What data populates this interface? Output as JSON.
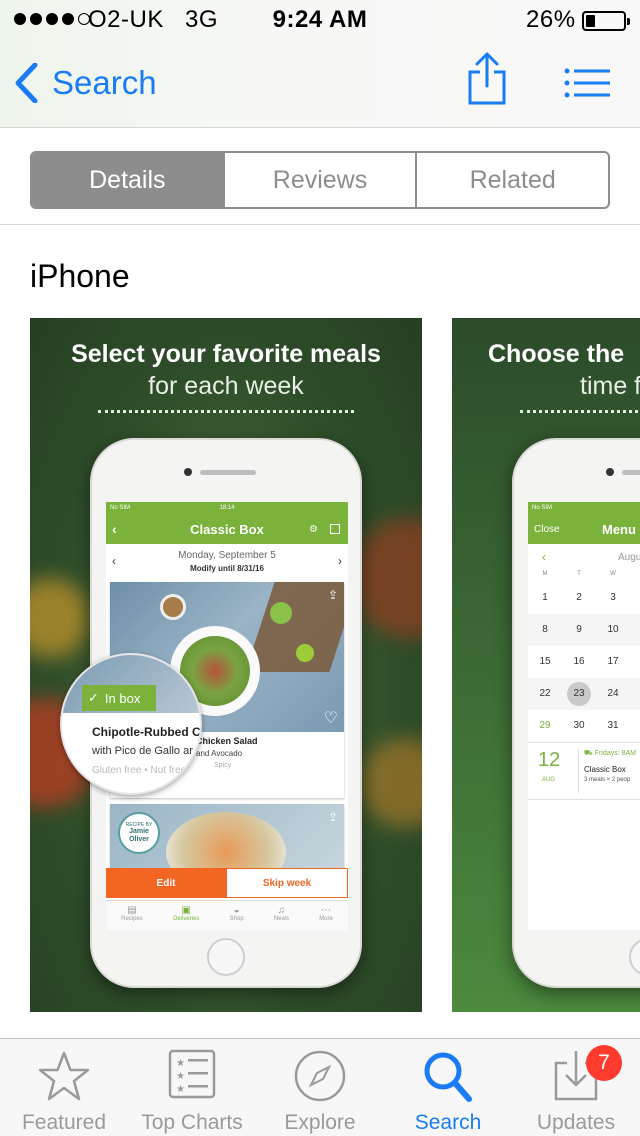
{
  "status_bar": {
    "carrier": "O2-UK",
    "network": "3G",
    "time": "9:24 AM",
    "battery": "26%",
    "battery_level": 0.26
  },
  "nav": {
    "back_label": "Search"
  },
  "segments": [
    {
      "label": "Details",
      "active": true
    },
    {
      "label": "Reviews",
      "active": false
    },
    {
      "label": "Related",
      "active": false
    }
  ],
  "section_title": "iPhone",
  "screenshot1": {
    "headline": "Select your favorite meals",
    "subline": "for each week",
    "app": {
      "status_left": "No SIM",
      "status_time": "18:14",
      "title": "Classic Box",
      "date": "Monday, September 5",
      "modify": "Modify until 8/31/16",
      "card_title": "Chicken Salad",
      "card_subtitle": "and Avocado",
      "card_tags": "Spicy",
      "badge": "In box",
      "zoom_title": "Chipotle-Rubbed C",
      "zoom_subtitle": "with Pico de Gallo ar",
      "zoom_tags": "Gluten free",
      "zoom_tags2": "Nut free",
      "chef_top": "RECIPE BY",
      "chef_name": "Jamie Oliver",
      "edit": "Edit",
      "skip": "Skip week",
      "tabs": [
        "Recipes",
        "Deliveries",
        "Shop",
        "News",
        "More"
      ]
    }
  },
  "screenshot2": {
    "headline": "Choose the",
    "subline": "time f",
    "app": {
      "status_left": "No SIM",
      "close": "Close",
      "title": "Menu C",
      "month": "Augu",
      "weekdays": [
        "M",
        "T",
        "W"
      ],
      "weeks": [
        [
          "1",
          "2",
          "3"
        ],
        [
          "8",
          "9",
          "10"
        ],
        [
          "15",
          "16",
          "17"
        ],
        [
          "22",
          "23",
          "24"
        ],
        [
          "29",
          "30",
          "31"
        ]
      ],
      "day": "12",
      "mon": "AUG",
      "delivery": "Fridays: 8AM",
      "box": "Classic Box",
      "meals": "3 meals × 2 peop"
    }
  },
  "tabbar": [
    {
      "label": "Featured",
      "icon": "star-icon"
    },
    {
      "label": "Top Charts",
      "icon": "list-icon"
    },
    {
      "label": "Explore",
      "icon": "compass-icon"
    },
    {
      "label": "Search",
      "icon": "search-icon",
      "active": true
    },
    {
      "label": "Updates",
      "icon": "download-icon",
      "badge": "7"
    }
  ],
  "colors": {
    "accent": "#1a7cf5",
    "app_green": "#7ab23c",
    "app_orange": "#f26522",
    "badge": "#ff3b30"
  }
}
